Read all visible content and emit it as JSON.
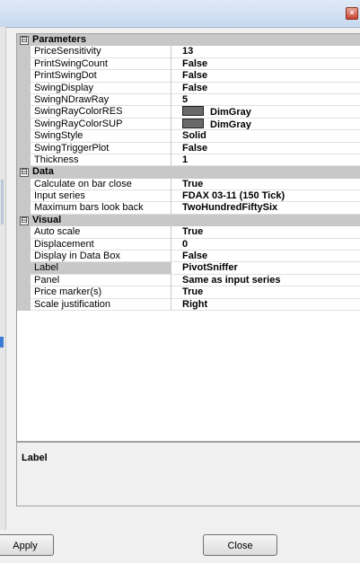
{
  "window": {
    "close_glyph": "×"
  },
  "categories": [
    {
      "label": "Parameters",
      "toggle": "⊟",
      "properties": [
        {
          "name": "PriceSensitivity",
          "value": "13"
        },
        {
          "name": "PrintSwingCount",
          "value": "False"
        },
        {
          "name": "PrintSwingDot",
          "value": "False"
        },
        {
          "name": "SwingDisplay",
          "value": "False"
        },
        {
          "name": "SwingNDrawRay",
          "value": "5"
        },
        {
          "name": "SwingRayColorRES",
          "value": "DimGray",
          "swatch": "#696969"
        },
        {
          "name": "SwingRayColorSUP",
          "value": "DimGray",
          "swatch": "#696969"
        },
        {
          "name": "SwingStyle",
          "value": "Solid"
        },
        {
          "name": "SwingTriggerPlot",
          "value": "False"
        },
        {
          "name": "Thickness",
          "value": "1"
        }
      ]
    },
    {
      "label": "Data",
      "toggle": "⊟",
      "properties": [
        {
          "name": "Calculate on bar close",
          "value": "True"
        },
        {
          "name": "Input series",
          "value": "FDAX 03-11 (150 Tick)"
        },
        {
          "name": "Maximum bars look back",
          "value": "TwoHundredFiftySix"
        }
      ]
    },
    {
      "label": "Visual",
      "toggle": "⊟",
      "properties": [
        {
          "name": "Auto scale",
          "value": "True"
        },
        {
          "name": "Displacement",
          "value": "0"
        },
        {
          "name": "Display in Data Box",
          "value": "False"
        },
        {
          "name": "Label",
          "value": "PivotSniffer",
          "selected": true
        },
        {
          "name": "Panel",
          "value": "Same as input series"
        },
        {
          "name": "Price marker(s)",
          "value": "True"
        },
        {
          "name": "Scale justification",
          "value": "Right"
        }
      ]
    }
  ],
  "description": {
    "title": "Label"
  },
  "buttons": {
    "apply_label": "Apply",
    "close_label": "Close"
  }
}
